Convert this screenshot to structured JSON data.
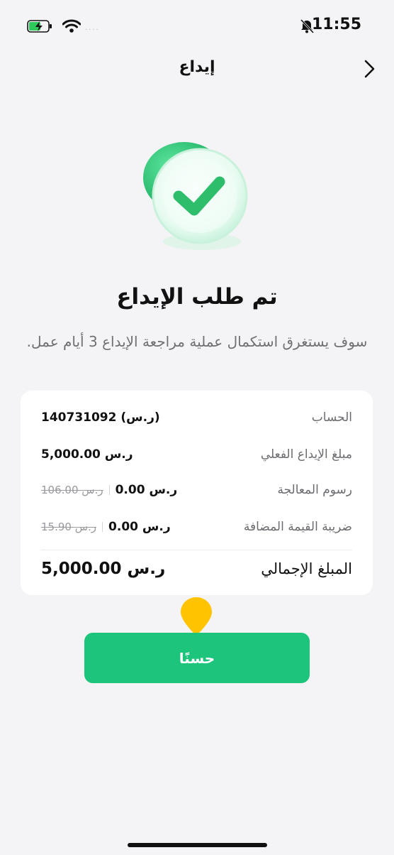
{
  "status_bar": {
    "time": "11:55",
    "signal_dots": "...."
  },
  "header": {
    "title": "إيداع"
  },
  "hero": {
    "icon": "success-check-icon"
  },
  "result": {
    "headline": "تم طلب الإيداع",
    "subtitle": "سوف يستغرق استكمال عملية مراجعة الإيداع 3 أيام عمل."
  },
  "summary": {
    "rows": [
      {
        "label": "الحساب",
        "value": "140731092 (ر.س)"
      },
      {
        "label": "مبلغ الإيداع الفعلي",
        "value": "5,000.00 ر.س"
      },
      {
        "label": "رسوم المعالجة",
        "value": "0.00 ر.س",
        "original": "106.00 ر.س"
      },
      {
        "label": "ضريبة القيمة المضافة",
        "value": "0.00 ر.س",
        "original": "15.90 ر.س"
      }
    ],
    "total": {
      "label": "المبلغ الإجمالي",
      "value": "5,000.00 ر.س"
    }
  },
  "actions": {
    "ok_label": "حسنًا"
  },
  "colors": {
    "accent": "#1dc47b",
    "pin": "#ffc300",
    "background": "#f4f4f6"
  }
}
